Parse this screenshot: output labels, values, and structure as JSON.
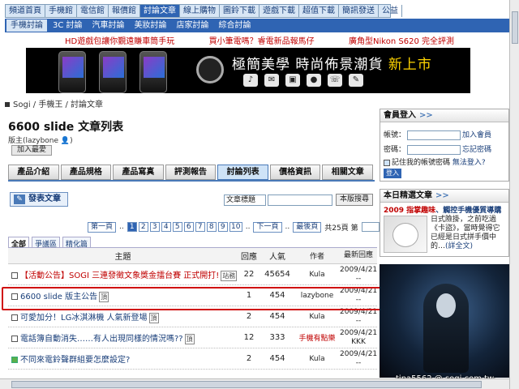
{
  "topnav": {
    "items": [
      "頻道首頁",
      "手機館",
      "電信館",
      "報價館",
      "討論文章",
      "線上購物",
      "圖鈴下載",
      "遊戲下載",
      "超值下載",
      "簡訊發送",
      "公益"
    ],
    "active_index": 4
  },
  "subnav": {
    "items": [
      "手機討論",
      "3C 討論",
      "汽車討論",
      "美妝討論",
      "店家討論",
      "綜合討論"
    ],
    "active_index": 0
  },
  "promo_links": [
    "HD遊戲包讓你覲遠賺車筒手玩",
    "買小筆電嗎？睿電新品報馬仔",
    "廣角型Nikon S620 完全評測"
  ],
  "banner": {
    "slogan": "極簡美學 時尚佈景潮貨",
    "slogan_new": "新上市"
  },
  "breadcrumb": "Sogi / 手機王 / 討論文章",
  "page_title": "6600 slide 文章列表",
  "moderator": "版主(lazybone 👤)",
  "add_favorite": "加入最愛",
  "tabs": {
    "items": [
      "產品介紹",
      "產品規格",
      "產品寫真",
      "評測報告",
      "討論列表",
      "價格資訊",
      "相關文章"
    ],
    "active_index": 4
  },
  "post_button": "發表文章",
  "search": {
    "select_value": "文章標題",
    "button": "本版搜尋"
  },
  "pager": {
    "first": "第一頁",
    "pages": [
      "1",
      "2",
      "3",
      "4",
      "5",
      "6",
      "7",
      "8",
      "9",
      "10"
    ],
    "current_index": 0,
    "next": "下一頁",
    "last": "最後頁",
    "total_text": "共25頁 第",
    "page_suffix": "頁",
    "go": "Go"
  },
  "filter_tabs": [
    "全部",
    "爭議區",
    "精化篇"
  ],
  "table": {
    "headers": {
      "title": "主題",
      "replies": "回應",
      "views": "人氣",
      "author": "作者",
      "last": "最新回應"
    },
    "rows": [
      {
        "title": "【活動公告】SOGI 三連發徵文象獎金擂台賽 正式開打!",
        "tag": "站務",
        "replies": "22",
        "views": "45654",
        "author": "Kula",
        "last": "2009/4/21 --",
        "red": true,
        "green": false
      },
      {
        "title": "6600 slide 版主公告",
        "tag": "頂",
        "replies": "1",
        "views": "454",
        "author": "lazybone",
        "last": "2009/4/21 --",
        "red": false,
        "green": false
      },
      {
        "title": "可愛加分！LG冰淇淋機 人氣新登場",
        "tag": "頂",
        "replies": "2",
        "views": "454",
        "author": "Kula",
        "last": "2009/4/21 --",
        "red": false,
        "green": false
      },
      {
        "title": "電話簿自動消失……有人出現同樣的情況嗎??",
        "tag": "頂",
        "replies": "12",
        "views": "333",
        "author": "手機有點樂",
        "last": "2009/4/21 KKK",
        "red": false,
        "green": false,
        "author_red": true
      },
      {
        "title": "不同來電鈴聲群組要怎麼設定?",
        "tag": "",
        "replies": "2",
        "views": "454",
        "author": "Kula",
        "last": "2009/4/21 --",
        "red": false,
        "green": true
      }
    ]
  },
  "login": {
    "title": "會員登入",
    "account_label": "帳號：",
    "password_label": "密碼：",
    "join": "加入會員",
    "forgot": "忘記密碼",
    "remember": "記住我的帳號密碼",
    "help": "無法登入?",
    "submit": "登入"
  },
  "featured": {
    "title": "本日精選文章",
    "headline_red": "2009 指掌趣味",
    "headline_blue": "、觸控手機優質導購",
    "desc": "日式險掛，之前吃過《卡盜》，當時覺得它已經是日式拼手價中的…",
    "more": "(詳全文)"
  },
  "watermark": "tina5562 @ sogi.com.tw",
  "colors": {
    "nav_blue": "#2f64b3",
    "highlight_red": "#d01010",
    "promo_red": "#c00000"
  }
}
